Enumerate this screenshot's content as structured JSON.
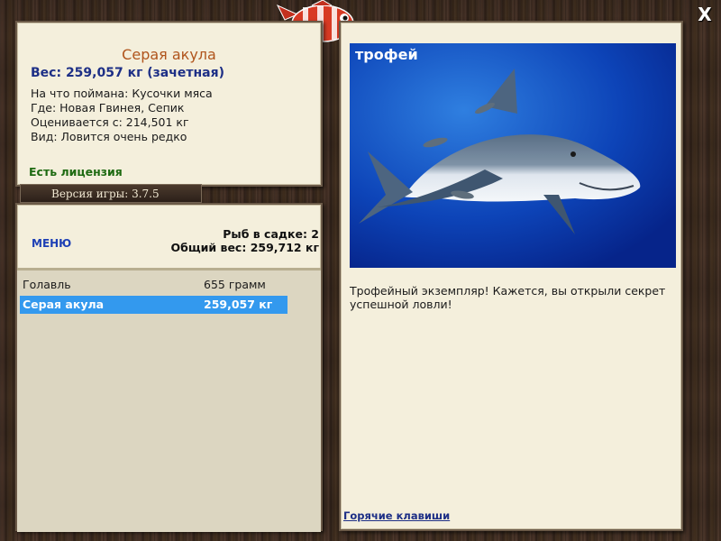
{
  "window": {
    "close_glyph": "X"
  },
  "catch_info": {
    "title": "Серая акула",
    "weight": "Вес: 259,057 кг (зачетная)",
    "bait": "На что поймана: Кусочки мяса",
    "location": "Где: Новая Гвинея, Сепик",
    "valued_from": "Оценивается с: 214,501 кг",
    "rarity": "Вид: Ловится очень редко",
    "license": "Есть лицензия"
  },
  "version": "Версия игры: 3.7.5",
  "keepnet": {
    "menu_label": "МЕНЮ",
    "fish_count": "Рыб в садке: 2",
    "total_weight": "Общий вес: 259,712 кг",
    "rows": [
      {
        "name": "Голавль",
        "weight": "655 грамм"
      },
      {
        "name": "Серая акула",
        "weight": "259,057 кг"
      }
    ]
  },
  "detail": {
    "trophy_label": "трофей",
    "description": "Трофейный экземпляр! Кажется, вы открыли секрет успешной ловли!",
    "hotkeys_link": "Горячие клавиши"
  },
  "colors": {
    "title": "#b0541c",
    "weight": "#1d2f86",
    "license": "#1e6a12",
    "selected_row": "#3399ee",
    "panel_bg": "#f4efdc"
  }
}
